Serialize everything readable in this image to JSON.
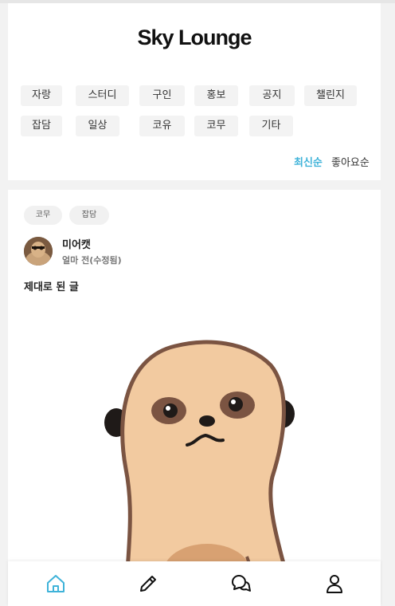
{
  "app": {
    "title": "Sky Lounge"
  },
  "categories": [
    "자랑",
    "스터디",
    "구인",
    "홍보",
    "공지",
    "챌린지",
    "잡담",
    "일상",
    "코유",
    "코무",
    "기타"
  ],
  "sort": {
    "latest": "최신순",
    "likes": "좋아요순",
    "active": "latest"
  },
  "post": {
    "tags": [
      "코무",
      "잡담"
    ],
    "author": "미어캣",
    "time": "얼마 전(수정됨)",
    "body": "제대로 된 글"
  },
  "nav": {
    "items": [
      "home-icon",
      "pencil-icon",
      "chat-icon",
      "user-icon"
    ],
    "active": "home-icon"
  },
  "colors": {
    "accent": "#3fb3d9",
    "background": "#f2f2f2",
    "chip": "#f3f3f3"
  }
}
